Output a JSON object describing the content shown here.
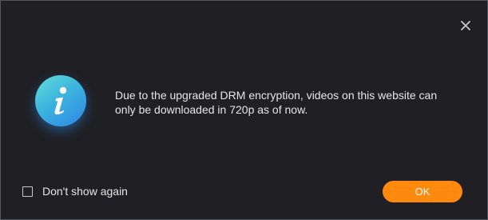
{
  "dialog": {
    "message": "Due to the upgraded DRM encryption, videos on this website can only be downloaded in 720p as of now.",
    "icon": "info-icon",
    "close_icon": "close-icon"
  },
  "footer": {
    "checkbox_label": "Don't show again",
    "checkbox_checked": false,
    "ok_label": "OK"
  },
  "colors": {
    "background": "#202024",
    "border": "#55565c",
    "text": "#e6e6e6",
    "accent": "#ff8a0d",
    "info_gradient_start": "#62e0d9",
    "info_gradient_end": "#2f86e6"
  }
}
